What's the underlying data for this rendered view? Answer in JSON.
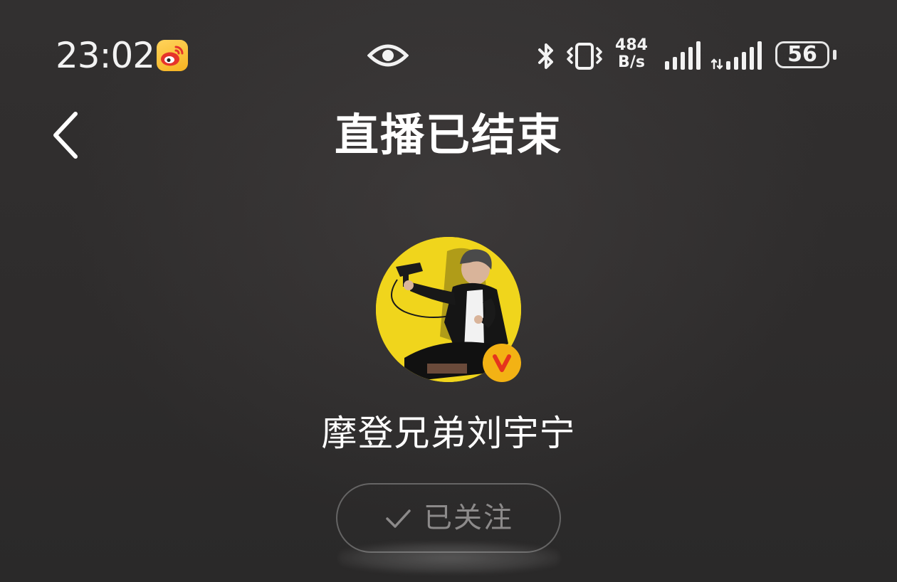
{
  "status_bar": {
    "time": "23:02",
    "net_speed_value": "484",
    "net_speed_unit": "B/s",
    "battery_level": "56",
    "icons": [
      "weibo-app-icon",
      "eye-icon",
      "bluetooth-icon",
      "vibrate-icon",
      "signal-icon",
      "signal-data-icon",
      "battery-icon"
    ]
  },
  "nav": {
    "back_icon": "chevron-left-icon",
    "title": "直播已结束"
  },
  "profile": {
    "name": "摩登兄弟刘宇宁",
    "verified_badge_letter": "V",
    "colors": {
      "avatar_background": "#f0d51c",
      "badge": "#f3b214",
      "badge_letter": "#e5341d"
    }
  },
  "follow_button": {
    "label": "已关注",
    "icon": "check-icon"
  }
}
